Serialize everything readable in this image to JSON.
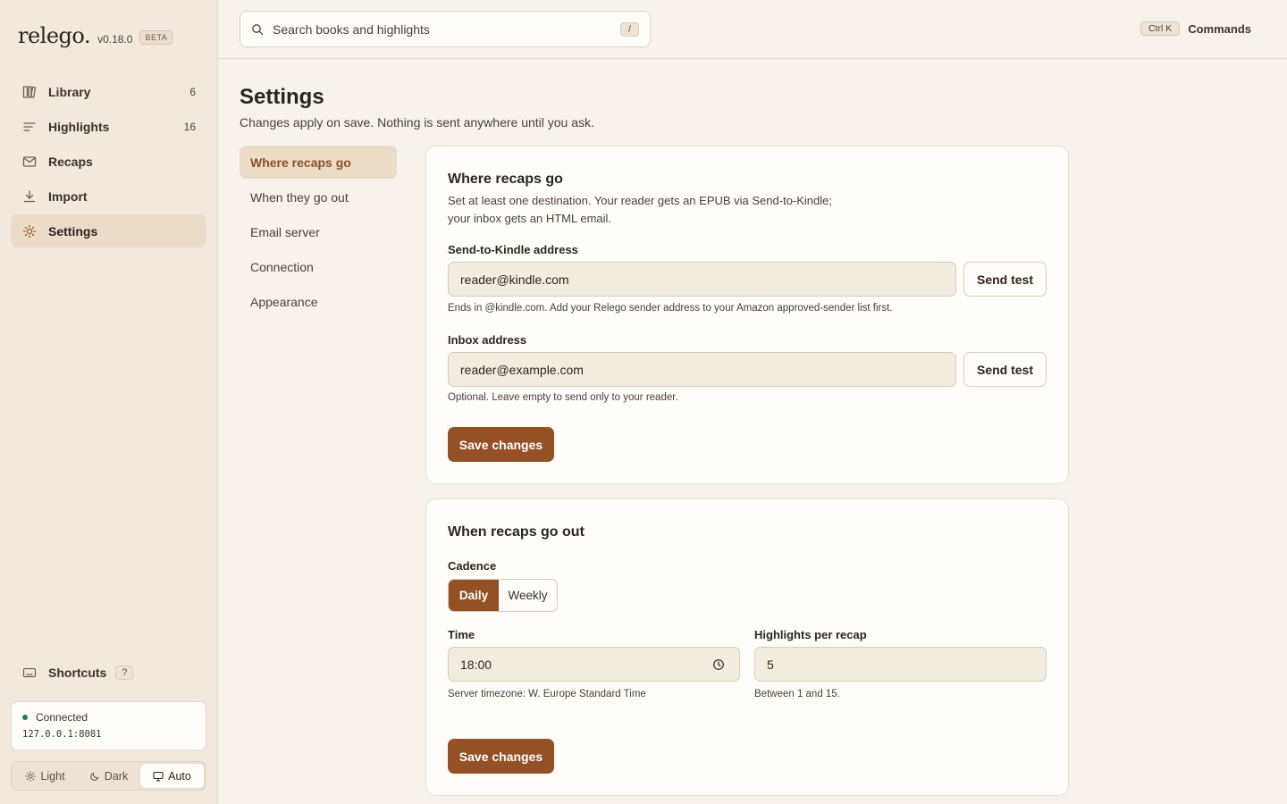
{
  "brand": {
    "logo": "relego.",
    "version": "v0.18.0",
    "badge": "BETA"
  },
  "nav": {
    "items": [
      {
        "label": "Library",
        "count": "6",
        "icon": "library-icon"
      },
      {
        "label": "Highlights",
        "count": "16",
        "icon": "highlights-icon"
      },
      {
        "label": "Recaps",
        "count": "",
        "icon": "mail-icon"
      },
      {
        "label": "Import",
        "count": "",
        "icon": "download-icon"
      },
      {
        "label": "Settings",
        "count": "",
        "icon": "gear-icon",
        "active": true
      }
    ]
  },
  "shortcuts": {
    "label": "Shortcuts",
    "key": "?"
  },
  "connection": {
    "status": "Connected",
    "address": "127.0.0.1:8081",
    "status_color": "#2f7a4f"
  },
  "theme": {
    "options": [
      "Light",
      "Dark",
      "Auto"
    ],
    "selected": "Auto"
  },
  "search": {
    "placeholder": "Search books and highlights",
    "value": "",
    "shortcut": "/"
  },
  "commands": {
    "shortcut": "Ctrl K",
    "label": "Commands"
  },
  "page": {
    "title": "Settings",
    "subtitle": "Changes apply on save. Nothing is sent anywhere until you ask."
  },
  "subnav": {
    "items": [
      "Where recaps go",
      "When they go out",
      "Email server",
      "Connection",
      "Appearance"
    ],
    "active": "Where recaps go"
  },
  "destinations": {
    "title": "Where recaps go",
    "description_line1": "Set at least one destination. Your reader gets an EPUB via Send-to-Kindle;",
    "description_line2": "your inbox gets an HTML email.",
    "kindle_label": "Send-to-Kindle address",
    "kindle_value": "reader@kindle.com",
    "kindle_hint": "Ends in @kindle.com. Add your Relego sender address to your Amazon approved-sender list first.",
    "inbox_label": "Inbox address",
    "inbox_value": "reader@example.com",
    "inbox_hint": "Optional. Leave empty to send only to your reader.",
    "send_test_label": "Send test",
    "save_label": "Save changes"
  },
  "schedule": {
    "title": "When recaps go out",
    "cadence_label": "Cadence",
    "cadence_options": [
      "Daily",
      "Weekly"
    ],
    "cadence_selected": "Daily",
    "time_label": "Time",
    "time_value": "18:00",
    "time_hint": "Server timezone: W. Europe Standard Time",
    "count_label": "Highlights per recap",
    "count_value": "5",
    "count_hint": "Between 1 and 15.",
    "save_label": "Save changes"
  },
  "colors": {
    "accent": "#955126",
    "background": "#f7f3ec",
    "sidebar": "#f1e9dd",
    "card": "#fffdf9"
  }
}
